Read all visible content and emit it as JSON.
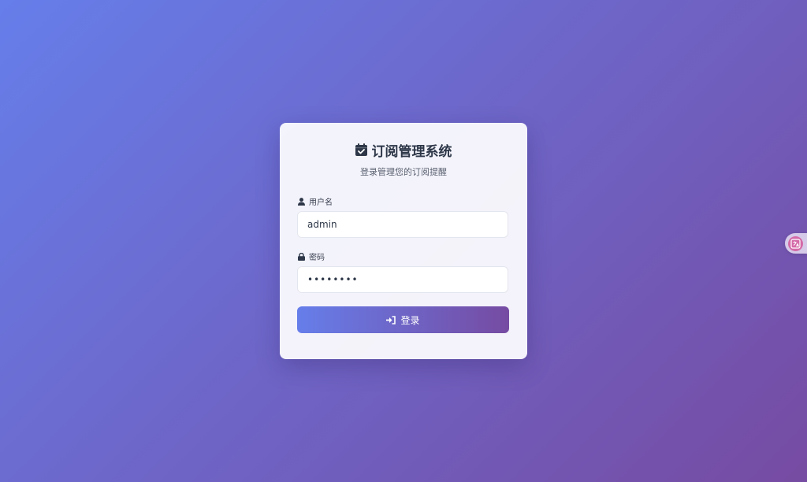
{
  "header": {
    "title": "订阅管理系统",
    "subtitle": "登录管理您的订阅提醒",
    "icon": "calendar-check-icon"
  },
  "form": {
    "username_label": "用户名",
    "username_icon": "user-icon",
    "username_value": "admin",
    "password_label": "密码",
    "password_icon": "lock-icon",
    "password_value": "admin123",
    "login_label": "登录",
    "login_icon": "sign-in-icon"
  },
  "widgets": {
    "translate_icon": "translate-icon"
  },
  "colors": {
    "gradient_start": "#667eea",
    "gradient_end": "#764ba2",
    "card_background": "#f0eff8",
    "title_color": "#2d3748",
    "translate_badge": "#d46aa8"
  }
}
